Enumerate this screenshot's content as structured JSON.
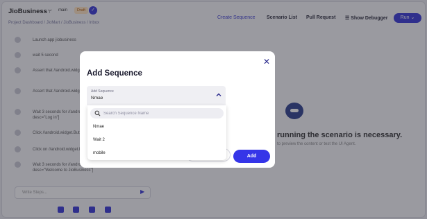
{
  "app": {
    "brand": "JioBusiness",
    "branch": "main",
    "badge": "Draft",
    "avatar_initial": "✓",
    "breadcrumb": "Project Dashboard  /  JioMart  /  JioBusiness  /  Inbox",
    "nav": {
      "create_sequence": "Create Sequence",
      "scenario_list": "Scenario List",
      "pull_request": "Pull Request",
      "show_debugger": "☰ Show Debugger",
      "run": "Run ⌄"
    }
  },
  "steps": [
    "Launch app jiobusiness",
    "wait 5 second",
    "Assert that //android.widget.TextView[@text=\"Sign in\"] exists",
    "Assert that //android.widget.TextView[@text=\"Sign in\"] exists",
    "Wait 3 seconds for //android.widget.Button[@content-desc=\"Log in\"]",
    "Click //android.widget.Button",
    "Click on //android.widget.Button",
    "Wait 3 seconds for //android.widget.TextView[@content-desc=\"Welcome to JioBusiness\"]"
  ],
  "prompt": {
    "placeholder": "Write Steps..."
  },
  "empty_state": {
    "title": "running the scenario is necessary.",
    "subtitle": "to preview the content or test the UI Agent."
  },
  "modal": {
    "title": "Add Sequence",
    "close_icon": "✕",
    "select": {
      "label": "Add Sequence",
      "value": "Nmae"
    },
    "search_placeholder": "Search Sequence Name",
    "options": [
      "Nmae",
      "Wait 2",
      "mobile"
    ],
    "cancel_label": "",
    "add_label": "Add"
  },
  "colors": {
    "accent": "#3535e8",
    "overlay": "rgba(40,40,50,0.45)"
  }
}
